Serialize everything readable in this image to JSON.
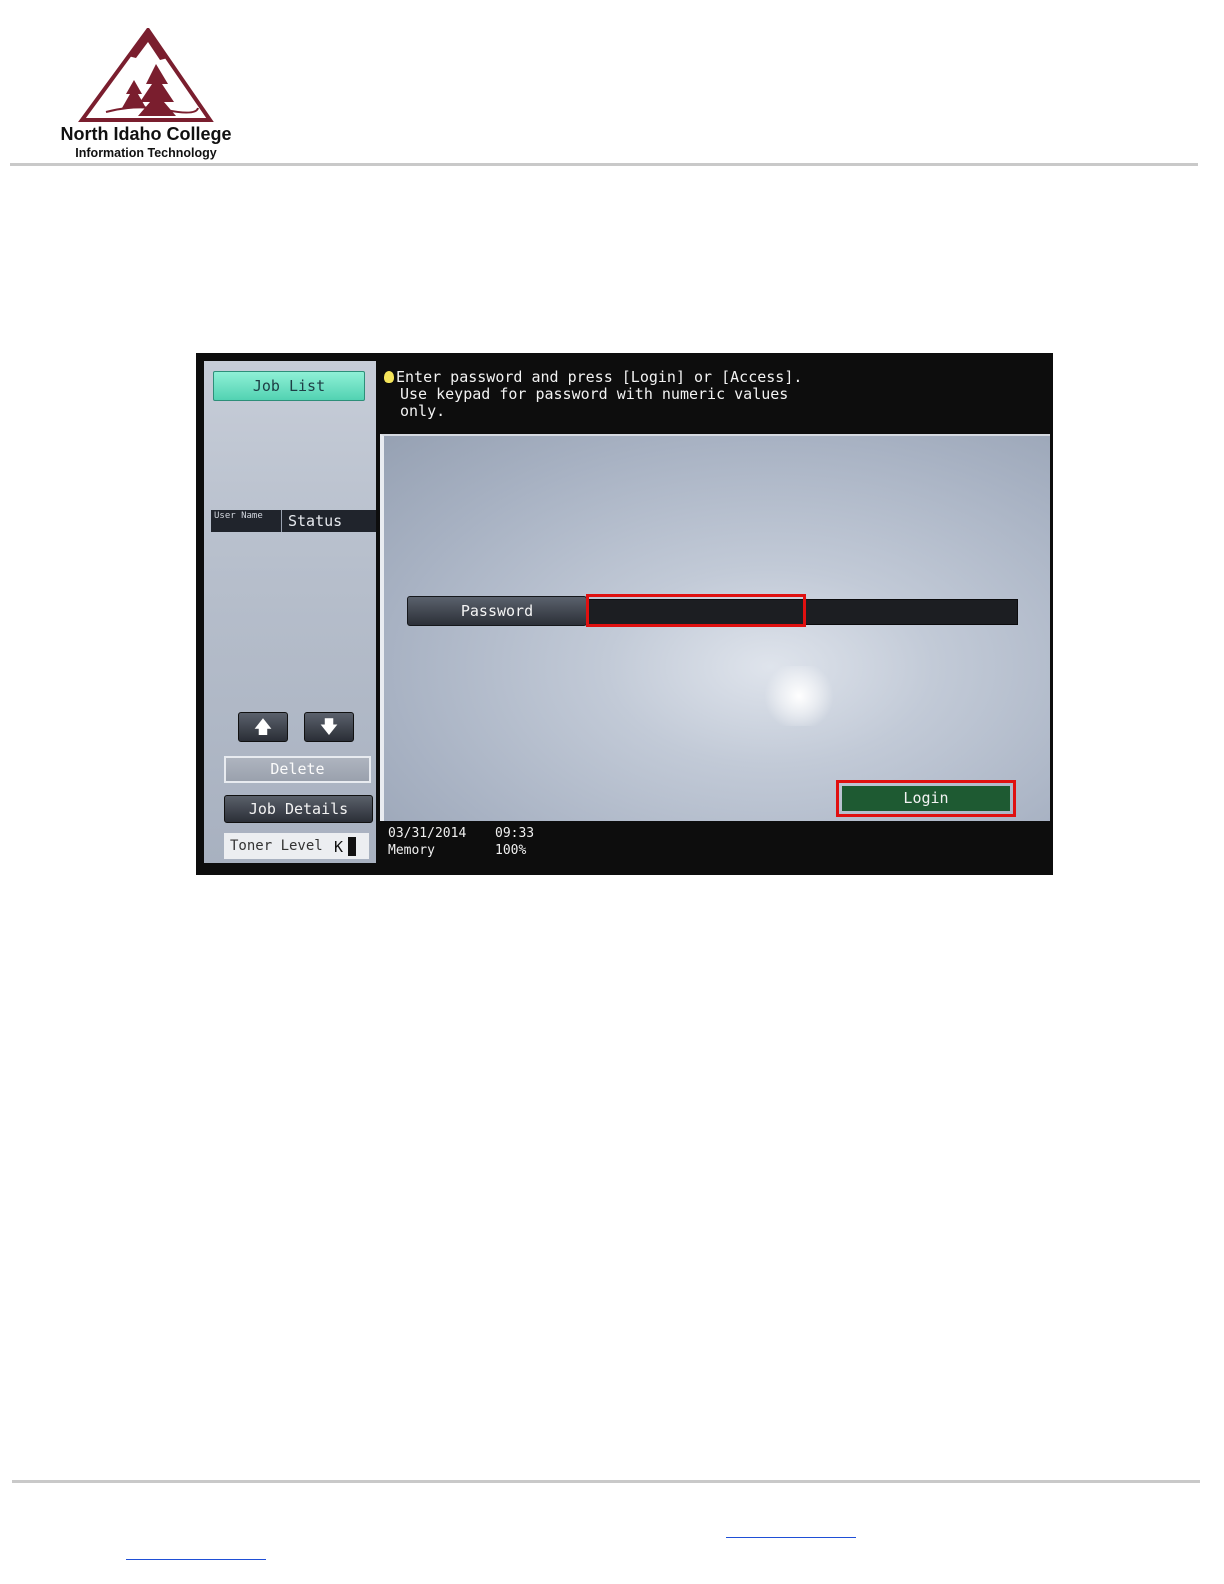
{
  "header": {
    "college": "North Idaho College",
    "department": "Information Technology"
  },
  "colors": {
    "brand": "#7a1e2e",
    "highlight": "#e01010",
    "joblist_button": "#52d2b2",
    "login_button": "#1e5a32"
  },
  "screen": {
    "left_panel": {
      "job_list_label": "Job List",
      "header_user": "User Name",
      "header_status": "Status",
      "up_arrow": "🡅",
      "down_arrow": "🡇",
      "delete_label": "Delete",
      "job_details_label": "Job Details",
      "toner_label": "Toner Level",
      "toner_color": "K"
    },
    "message": {
      "line1": "Enter password and press [Login] or [Access].",
      "line2": "Use keypad for password with numeric values",
      "line3": "only."
    },
    "password_label": "Password",
    "password_value": "",
    "login_label": "Login",
    "status": {
      "date": "03/31/2014",
      "time": "09:33",
      "memory_label": "Memory",
      "memory_value": "100%"
    }
  }
}
